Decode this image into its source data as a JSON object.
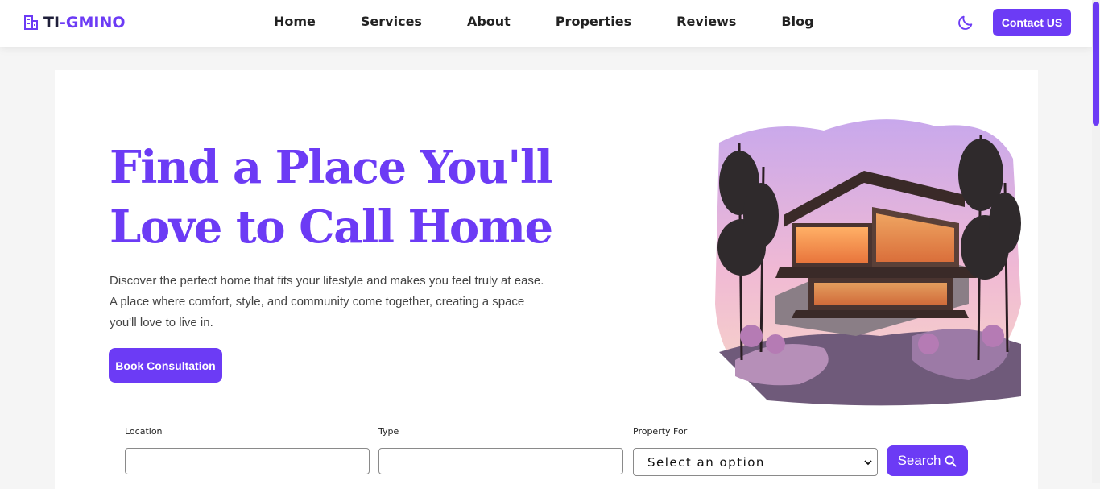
{
  "brand": {
    "ti": "TI",
    "dash": "-",
    "gm": "GMINO",
    "accent": "#6c3bf5"
  },
  "nav": {
    "links": [
      "Home",
      "Services",
      "About",
      "Properties",
      "Reviews",
      "Blog"
    ],
    "theme_icon": "moon-icon",
    "contact_label": "Contact US"
  },
  "hero": {
    "title": "Find a Place You'll Love to Call Home",
    "description": "Discover the perfect home that fits your lifestyle and makes you feel truly at ease. A place where comfort, style, and community come together, creating a space you'll love to live in.",
    "cta_label": "Book Consultation"
  },
  "search": {
    "location_label": "Location",
    "location_value": "",
    "type_label": "Type",
    "type_value": "",
    "property_for_label": "Property For",
    "property_for_selected": "Select an option",
    "search_label": "Search",
    "search_icon": "search-icon"
  }
}
